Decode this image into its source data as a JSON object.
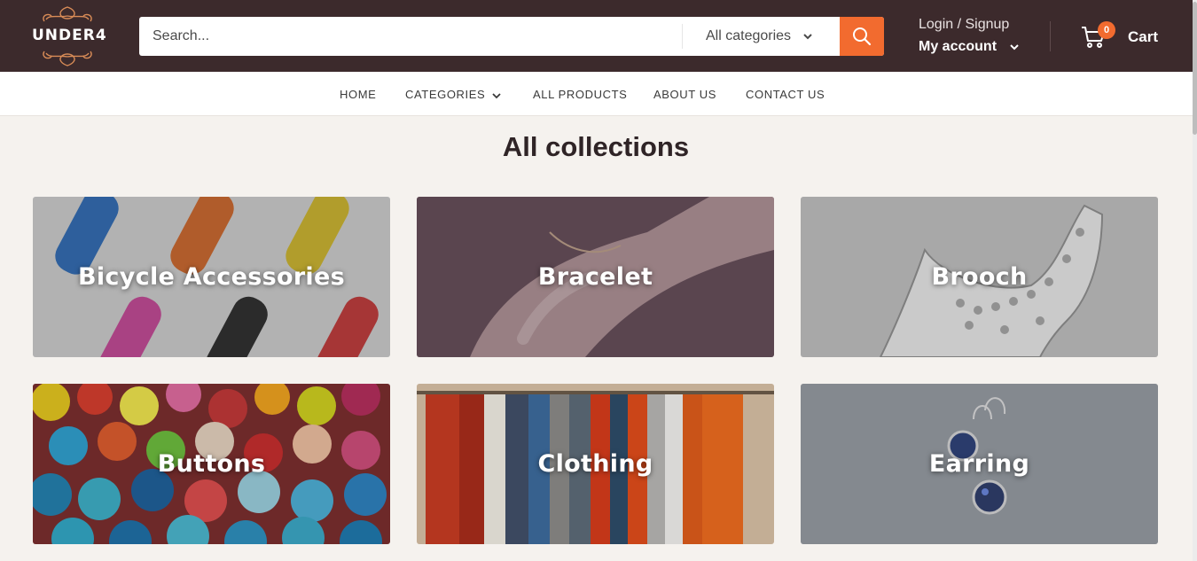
{
  "brand": {
    "logo_text": "UNDER4"
  },
  "colors": {
    "header_bg": "#3c2a2c",
    "accent": "#f26b2f",
    "page_bg": "#f5f2ee"
  },
  "search": {
    "placeholder": "Search...",
    "category_label": "All categories",
    "button_icon": "search-icon"
  },
  "account": {
    "login_label": "Login / Signup",
    "my_account_label": "My account"
  },
  "cart": {
    "count": "0",
    "label": "Cart"
  },
  "nav": {
    "items": [
      {
        "label": "HOME"
      },
      {
        "label": "CATEGORIES"
      },
      {
        "label": "ALL PRODUCTS"
      },
      {
        "label": "ABOUT US"
      },
      {
        "label": "CONTACT US"
      }
    ]
  },
  "main": {
    "title": "All collections",
    "collections": [
      {
        "label": "Bicycle Accessories"
      },
      {
        "label": "Bracelet"
      },
      {
        "label": "Brooch"
      },
      {
        "label": "Buttons"
      },
      {
        "label": "Clothing"
      },
      {
        "label": "Earring"
      }
    ]
  }
}
